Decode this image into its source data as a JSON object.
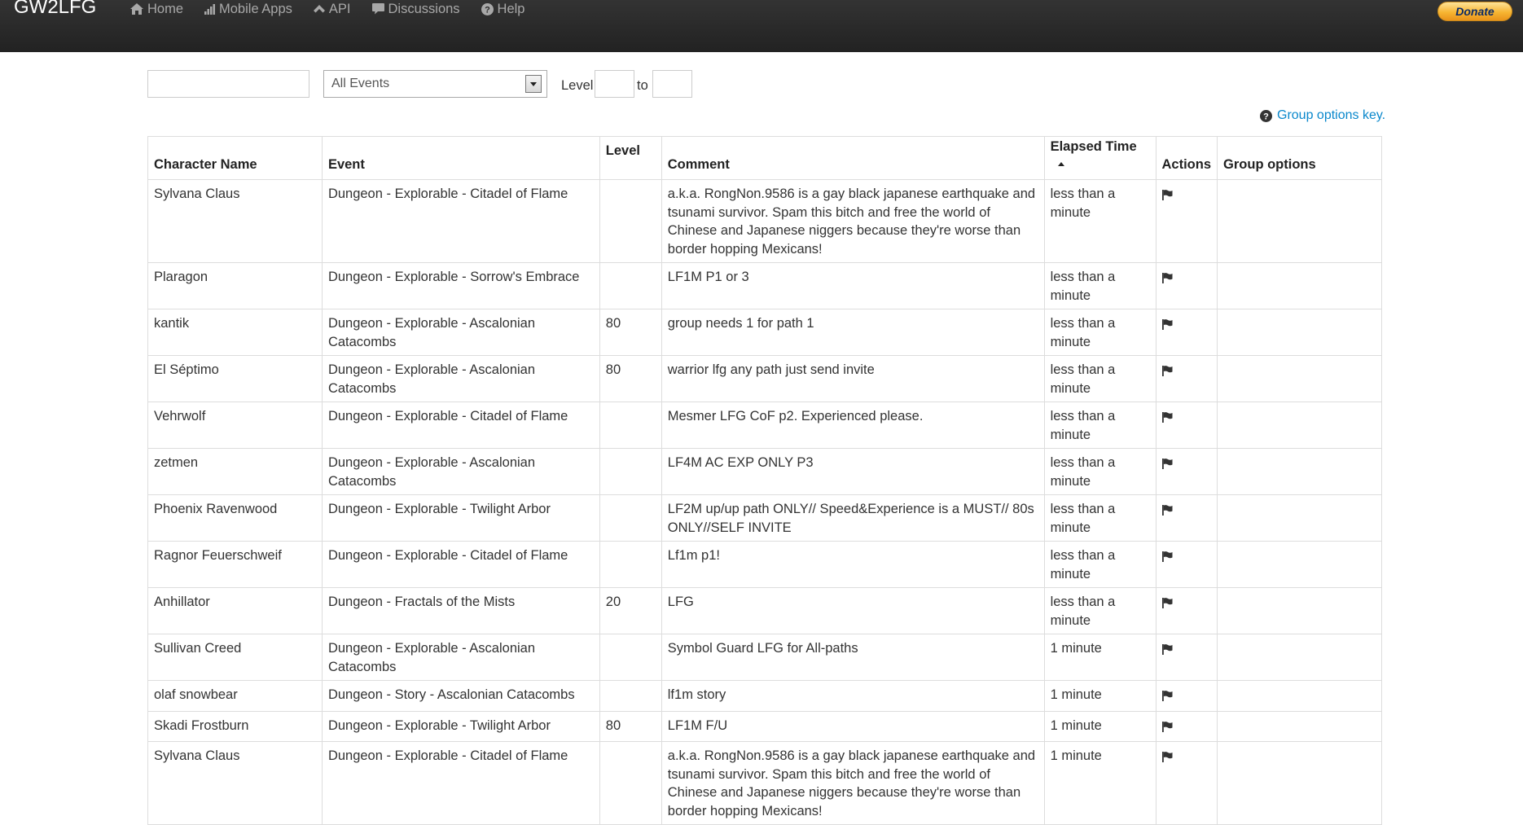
{
  "navbar": {
    "brand": "GW2LFG",
    "items": [
      {
        "label": "Home",
        "icon": "home-icon"
      },
      {
        "label": "Mobile Apps",
        "icon": "signal-icon"
      },
      {
        "label": "API",
        "icon": "chevron-up-icon"
      },
      {
        "label": "Discussions",
        "icon": "comment-icon"
      },
      {
        "label": "Help",
        "icon": "question-circle-icon"
      }
    ],
    "donate_label": "Donate"
  },
  "filters": {
    "search_value": "",
    "event_selected": "All Events",
    "level_label": "Level",
    "to_label": "to",
    "level_min": "",
    "level_max": ""
  },
  "group_options_key": "Group options key.",
  "table": {
    "headers": {
      "character_name": "Character Name",
      "event": "Event",
      "level": "Level",
      "comment": "Comment",
      "elapsed_time": "Elapsed Time",
      "actions": "Actions",
      "group_options": "Group options"
    },
    "rows": [
      {
        "name": "Sylvana Claus",
        "event": "Dungeon - Explorable - Citadel of Flame",
        "level": "",
        "comment": "a.k.a. RongNon.9586 is a gay black japanese earthquake and tsunami survivor. Spam this bitch and free the world of Chinese and Japanese niggers because they're worse than border hopping Mexicans!",
        "elapsed": "less than a minute"
      },
      {
        "name": "Plaragon",
        "event": "Dungeon - Explorable - Sorrow's Embrace",
        "level": "",
        "comment": "LF1M P1 or 3",
        "elapsed": "less than a minute"
      },
      {
        "name": "kantik",
        "event": "Dungeon - Explorable - Ascalonian Catacombs",
        "level": "80",
        "comment": "group needs 1 for path 1",
        "elapsed": "less than a minute"
      },
      {
        "name": "El Séptimo",
        "event": "Dungeon - Explorable - Ascalonian Catacombs",
        "level": "80",
        "comment": "warrior lfg any path just send invite",
        "elapsed": "less than a minute"
      },
      {
        "name": "Vehrwolf",
        "event": "Dungeon - Explorable - Citadel of Flame",
        "level": "",
        "comment": "Mesmer LFG CoF p2. Experienced please.",
        "elapsed": "less than a minute"
      },
      {
        "name": "zetmen",
        "event": "Dungeon - Explorable - Ascalonian Catacombs",
        "level": "",
        "comment": "LF4M AC EXP ONLY P3",
        "elapsed": "less than a minute"
      },
      {
        "name": "Phoenix Ravenwood",
        "event": "Dungeon - Explorable - Twilight Arbor",
        "level": "",
        "comment": "LF2M up/up path ONLY// Speed&Experience is a MUST// 80s ONLY//SELF INVITE",
        "elapsed": "less than a minute"
      },
      {
        "name": "Ragnor Feuerschweif",
        "event": "Dungeon - Explorable - Citadel of Flame",
        "level": "",
        "comment": "Lf1m p1!",
        "elapsed": "less than a minute"
      },
      {
        "name": "Anhillator",
        "event": "Dungeon - Fractals of the Mists",
        "level": "20",
        "comment": "LFG",
        "elapsed": "less than a minute"
      },
      {
        "name": "Sullivan Creed",
        "event": "Dungeon - Explorable - Ascalonian Catacombs",
        "level": "",
        "comment": "Symbol Guard LFG for All-paths",
        "elapsed": "1 minute"
      },
      {
        "name": "olaf snowbear",
        "event": "Dungeon - Story - Ascalonian Catacombs",
        "level": "",
        "comment": "lf1m story",
        "elapsed": "1 minute"
      },
      {
        "name": "Skadi Frostburn",
        "event": "Dungeon - Explorable - Twilight Arbor",
        "level": "80",
        "comment": "LF1M F/U",
        "elapsed": "1 minute"
      },
      {
        "name": "Sylvana Claus",
        "event": "Dungeon - Explorable - Citadel of Flame",
        "level": "",
        "comment": "a.k.a. RongNon.9586 is a gay black japanese earthquake and tsunami survivor. Spam this bitch and free the world of Chinese and Japanese niggers because they're worse than border hopping Mexicans!",
        "elapsed": "1 minute"
      }
    ]
  },
  "colors": {
    "navbar_bg": "#222222",
    "nav_text": "#a8a8a8",
    "link": "#0a88cc",
    "border": "#dddddd"
  }
}
